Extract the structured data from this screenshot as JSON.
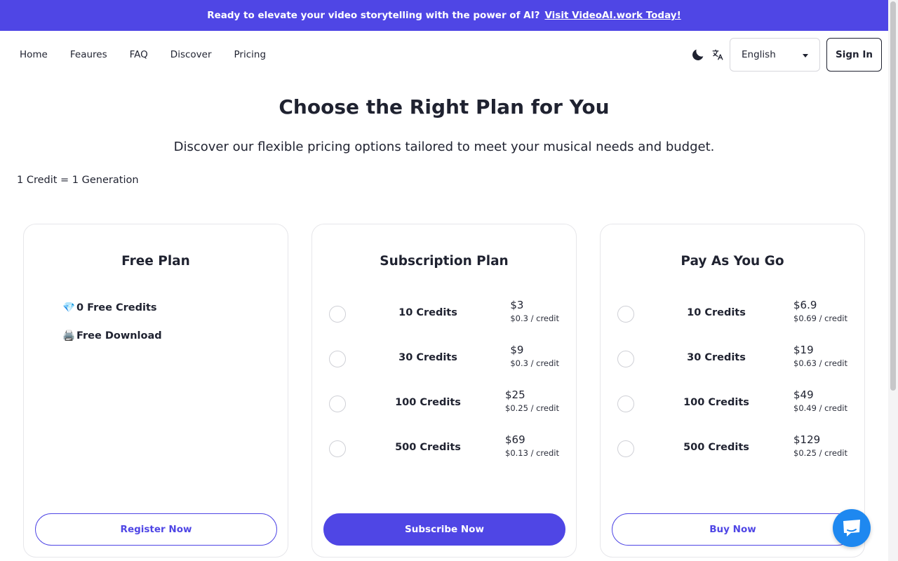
{
  "banner": {
    "text": "Ready to elevate your video storytelling with the power of AI?",
    "link_text": "Visit VideoAI.work Today!"
  },
  "nav": {
    "links": [
      "Home",
      "Feaures",
      "FAQ",
      "Discover",
      "Pricing"
    ],
    "language": "English",
    "sign_in": "Sign In"
  },
  "hero": {
    "title": "Choose the Right Plan for You",
    "subtitle": "Discover our flexible pricing options tailored to meet your musical needs and budget.",
    "credit_note": "1 Credit = 1 Generation"
  },
  "plans": {
    "free": {
      "title": "Free Plan",
      "features": [
        {
          "emoji": "💎",
          "text": "0 Free Credits"
        },
        {
          "emoji": "🖨️",
          "text": "Free Download"
        }
      ],
      "button": "Register Now"
    },
    "subscription": {
      "title": "Subscription Plan",
      "rows": [
        {
          "credits": "10 Credits",
          "price": "$3",
          "unit": "$0.3 / credit"
        },
        {
          "credits": "30 Credits",
          "price": "$9",
          "unit": "$0.3 / credit"
        },
        {
          "credits": "100 Credits",
          "price": "$25",
          "unit": "$0.25 / credit"
        },
        {
          "credits": "500 Credits",
          "price": "$69",
          "unit": "$0.13 / credit"
        }
      ],
      "button": "Subscribe Now"
    },
    "payg": {
      "title": "Pay As You Go",
      "rows": [
        {
          "credits": "10 Credits",
          "price": "$6.9",
          "unit": "$0.69 / credit"
        },
        {
          "credits": "30 Credits",
          "price": "$19",
          "unit": "$0.63 / credit"
        },
        {
          "credits": "100 Credits",
          "price": "$49",
          "unit": "$0.49 / credit"
        },
        {
          "credits": "500 Credits",
          "price": "$129",
          "unit": "$0.25 / credit"
        }
      ],
      "button": "Buy Now"
    }
  },
  "colors": {
    "accent": "#4f46e5",
    "chat": "#1e88f0"
  },
  "icons": {
    "theme_toggle": "moon-icon",
    "translate": "translate-icon",
    "dropdown": "chevron-down-icon",
    "chat": "chat-icon"
  }
}
